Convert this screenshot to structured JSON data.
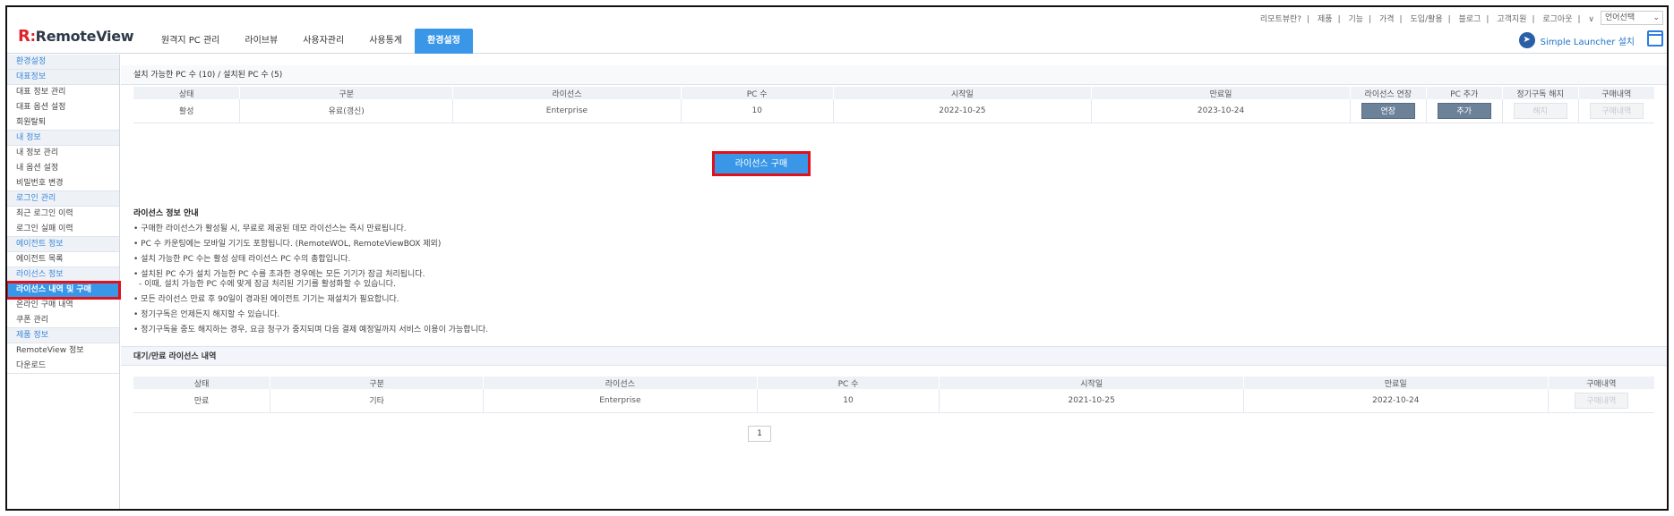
{
  "header": {
    "logo_mark": "R",
    "logo_colon": ":",
    "logo_text": "RemoteView",
    "nav": [
      "원격지 PC 관리",
      "라이브뷰",
      "사용자관리",
      "사용통계",
      "환경설정"
    ],
    "top_links": [
      "리모트뷰란?",
      "|",
      "제품",
      "|",
      "기능",
      "|",
      "가격",
      "|",
      "도입/활용",
      "|",
      "블로그",
      "|",
      "고객지원",
      "|",
      "로그아웃",
      "|",
      "∨"
    ],
    "lang_select": "언어선택",
    "launcher_label": "Simple Launcher 설치"
  },
  "sidebar": [
    {
      "type": "group",
      "label": "환경설정"
    },
    {
      "type": "group",
      "label": "대표정보"
    },
    {
      "type": "item",
      "label": "대표 정보 관리"
    },
    {
      "type": "item",
      "label": "대표 옵션 설정"
    },
    {
      "type": "item",
      "label": "회원탈퇴",
      "end": true
    },
    {
      "type": "group",
      "label": "내 정보"
    },
    {
      "type": "item",
      "label": "내 정보 관리"
    },
    {
      "type": "item",
      "label": "내 옵션 설정"
    },
    {
      "type": "item",
      "label": "비밀번호 변경",
      "end": true
    },
    {
      "type": "group",
      "label": "로그인 관리"
    },
    {
      "type": "item",
      "label": "최근 로그인 이력"
    },
    {
      "type": "item",
      "label": "로그인 실패 이력",
      "end": true
    },
    {
      "type": "group",
      "label": "에이전트 정보"
    },
    {
      "type": "item",
      "label": "에이전트 목록",
      "end": true
    },
    {
      "type": "group",
      "label": "라이선스 정보"
    },
    {
      "type": "item",
      "label": "라이선스 내역 및 구매",
      "active": true
    },
    {
      "type": "item",
      "label": "온라인 구매 내역"
    },
    {
      "type": "item",
      "label": "쿠폰 관리",
      "end": true
    },
    {
      "type": "group",
      "label": "제품 정보"
    },
    {
      "type": "item",
      "label": "RemoteView 정보"
    },
    {
      "type": "item",
      "label": "다운로드",
      "end": true
    }
  ],
  "license_section": {
    "title": "설치 가능한 PC 수 (10) / 설치된 PC 수 (5)",
    "headers": [
      "상태",
      "구분",
      "라이선스",
      "PC 수",
      "시작일",
      "만료일",
      "라이선스 연장",
      "PC 추가",
      "정기구독 해지",
      "구매내역"
    ],
    "row": [
      "활성",
      "유료(갱신)",
      "Enterprise",
      "10",
      "2022-10-25",
      "2023-10-24"
    ],
    "btn_extend": "연장",
    "btn_add": "추가",
    "btn_cancel": "해지",
    "btn_history": "구매내역",
    "buy_button": "라이선스 구매"
  },
  "info": {
    "title": "라이선스 정보 안내",
    "lines": [
      "• 구매한 라이선스가 활성될 시, 무료로 제공된 데모 라이선스는 즉시 만료됩니다.",
      "• PC 수 카운팅에는 모바일 기기도 포함됩니다. (RemoteWOL, RemoteViewBOX 제외)",
      "• 설치 가능한 PC 수는 활성 상태 라이선스 PC 수의 총합입니다.",
      "• 설치된 PC 수가 설치 가능한 PC 수를 초과한 경우에는 모든 기기가 잠금 처리됩니다.",
      "• 모든 라이선스 만료 후 90일이 경과된 에이전트 기기는 재설치가 필요합니다.",
      "• 정기구독은 언제든지 해지할 수 있습니다.",
      "• 정기구독을 중도 해지하는 경우, 요금 청구가 중지되며 다음 결제 예정일까지 서비스 이용이 가능합니다."
    ],
    "sub_line": "- 이때, 설치 가능한 PC 수에 맞게 잠금 처리된 기기를 활성화할 수 있습니다."
  },
  "expired_section": {
    "title": "대기/만료 라이선스 내역",
    "headers": [
      "상태",
      "구분",
      "라이선스",
      "PC 수",
      "시작일",
      "만료일",
      "구매내역"
    ],
    "row": [
      "만료",
      "기타",
      "Enterprise",
      "10",
      "2021-10-25",
      "2022-10-24"
    ],
    "btn_history": "구매내역",
    "page": "1"
  }
}
